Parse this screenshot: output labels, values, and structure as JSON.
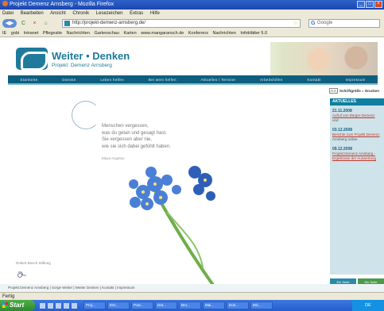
{
  "browser": {
    "title": "Projekt Demenz Arnsberg - Mozilla Firefox",
    "menu": [
      "Datei",
      "Bearbeiten",
      "Ansicht",
      "Chronik",
      "Lesezeichen",
      "Extras",
      "Hilfe"
    ],
    "url": "http://projekt-demenz-arnsberg.de/",
    "search_engine": "Google",
    "bookmarks": [
      "IE",
      "gobi",
      "Intranet",
      "Pflegesite",
      "Nachrichten",
      "Gartenschau",
      "Karten",
      "www.mangaransch.de",
      "Konferenz",
      "Nachrichten",
      "Infoblätter 5.0"
    ],
    "status": "Fertig"
  },
  "site": {
    "logo_title": "Weiter • Denken",
    "logo_subtitle": "Projekt: Demenz Arnsberg",
    "nav": [
      "Startseite",
      "Dienste",
      "Leben helfen",
      "Bei wem helfen",
      "Aktuelles / Termine",
      "Arbeitshilfen",
      "Kontakt",
      "Impressum"
    ],
    "quote": {
      "lines": [
        "Menschen vergessen,",
        "was du getan und gesagt hast.",
        "Sie vergessen aber nie,",
        "wie sie sich dabei gefühlt haben."
      ],
      "author": "Maya Angelou"
    },
    "stiftung": "Robert Bosch Stiftung",
    "bottom_links": "Start | Sitemap | Impressum",
    "footer": "Projekt Demenz Arnsberg | Sorge Weiter | Weiter Denken | Kontakt | Impressum"
  },
  "sidebar": {
    "tools": [
      "Schriftgröße",
      "Drucken"
    ],
    "heading": "AKTUELLES",
    "news": [
      {
        "date": "21.11.2008",
        "text": "Aufruf von Bürger-Demenz",
        "extra": "und"
      },
      {
        "date": "03.12.2008",
        "text": "Berichte zum Projekt Demenz",
        "extra": "Arnsberg online"
      },
      {
        "date": "09.12.2008",
        "text": "Projekt Demenz Arnsberg - Ergebnisse der Auswertung",
        "extra": ""
      }
    ],
    "buttons": [
      "Ein Seite",
      "Ein Seite"
    ]
  },
  "taskbar": {
    "start": "Start",
    "tasks": [
      "Proj...",
      "Ent...",
      "Pow...",
      "Dat...",
      "Bro...",
      "Mai...",
      "Dok...",
      "Mic..."
    ],
    "clock": "DE"
  },
  "colors": {
    "brand": "#1f7a9c",
    "nav": "#0e5f7f",
    "news_link": "#c0392b"
  }
}
